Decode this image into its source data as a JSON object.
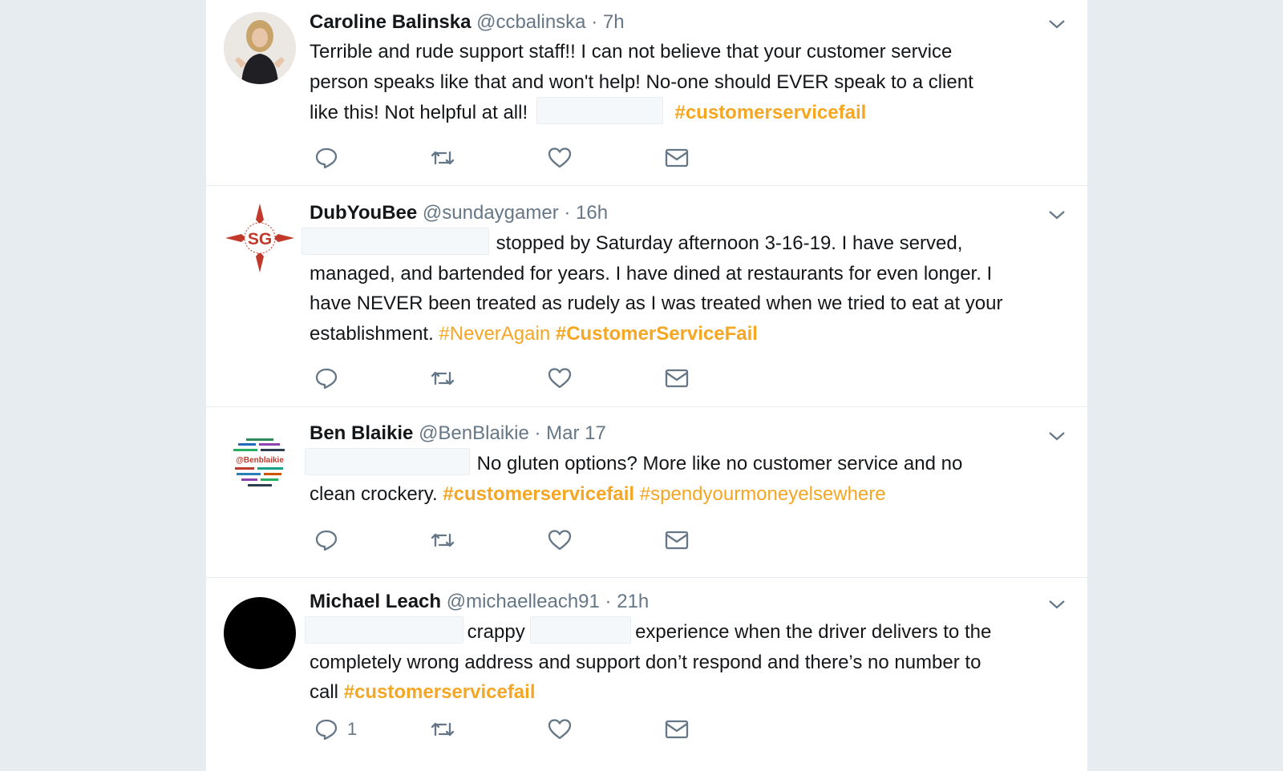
{
  "tweets": [
    {
      "name": "Caroline Balinska",
      "handle": "@ccbalinska",
      "separator": "·",
      "time": "7h",
      "text": {
        "line1": "Terrible and rude support staff!! I can not believe that your customer service",
        "line2": "person speaks like that and won't help! No-one should EVER speak to a client",
        "line3_pre": "like this! Not helpful at all!",
        "hashtag1": "#customerservicefail"
      }
    },
    {
      "name": "DubYouBee",
      "handle": "@sundaygamer",
      "separator": "·",
      "time": "16h",
      "avatar_text": "SG",
      "text": {
        "line1_post": "stopped by Saturday afternoon 3-16-19. I have served,",
        "line2": "managed, and bartended for years. I have dined at restaurants for even longer. I",
        "line3": "have NEVER been treated as rudely as I was treated when we tried to eat at your",
        "line4_pre": "establishment.",
        "hashtag1": "#NeverAgain",
        "hashtag2": "#CustomerServiceFail"
      }
    },
    {
      "name": "Ben Blaikie",
      "handle": "@BenBlaikie",
      "separator": "·",
      "time": "Mar 17",
      "avatar_text": "@Benblaikie",
      "text": {
        "line1_post": "No gluten options? More like no customer service and no",
        "line2_pre": "clean crockery.",
        "hashtag1": "#customerservicefail",
        "hashtag2": "#spendyourmoneyelsewhere"
      }
    },
    {
      "name": "Michael Leach",
      "handle": "@michaelleach91",
      "separator": "·",
      "time": "21h",
      "text": {
        "line1_mid": "crappy",
        "line1_post": "experience when the driver delivers to the",
        "line2": "completely wrong address and support don’t respond and there’s no number to",
        "line3_pre": "call",
        "hashtag1": "#customerservicefail"
      },
      "reply_count": "1"
    }
  ],
  "icons": {
    "reply": "reply-icon",
    "retweet": "retweet-icon",
    "like": "heart-icon",
    "dm": "envelope-icon",
    "caret": "chevron-down-icon"
  },
  "colors": {
    "hashtag": "#f5a623",
    "icon": "#657786",
    "background": "#e6ecf0"
  }
}
